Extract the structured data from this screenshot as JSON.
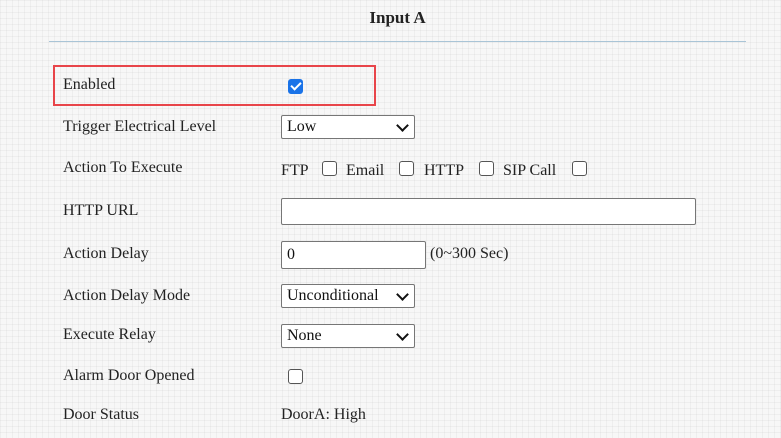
{
  "section": {
    "title": "Input A"
  },
  "fields": {
    "enabled": {
      "label": "Enabled",
      "checked": true
    },
    "trigger_level": {
      "label": "Trigger Electrical Level",
      "value": "Low"
    },
    "action_to_execute": {
      "label": "Action To Execute",
      "options": [
        {
          "label": "FTP",
          "checked": false
        },
        {
          "label": "Email",
          "checked": false
        },
        {
          "label": "HTTP",
          "checked": false
        },
        {
          "label": "SIP Call",
          "checked": false
        }
      ]
    },
    "http_url": {
      "label": "HTTP URL",
      "value": ""
    },
    "action_delay": {
      "label": "Action Delay",
      "value": "0",
      "hint": "(0~300 Sec)"
    },
    "action_delay_mode": {
      "label": "Action Delay Mode",
      "value": "Unconditional"
    },
    "execute_relay": {
      "label": "Execute Relay",
      "value": "None"
    },
    "alarm_door_opened": {
      "label": "Alarm Door Opened",
      "checked": false
    },
    "door_status": {
      "label": "Door Status",
      "value": "DoorA: High"
    }
  },
  "colors": {
    "highlight_border": "#e8454a",
    "checkbox_accent": "#1a73e8",
    "divider": "#a9c4d6"
  }
}
